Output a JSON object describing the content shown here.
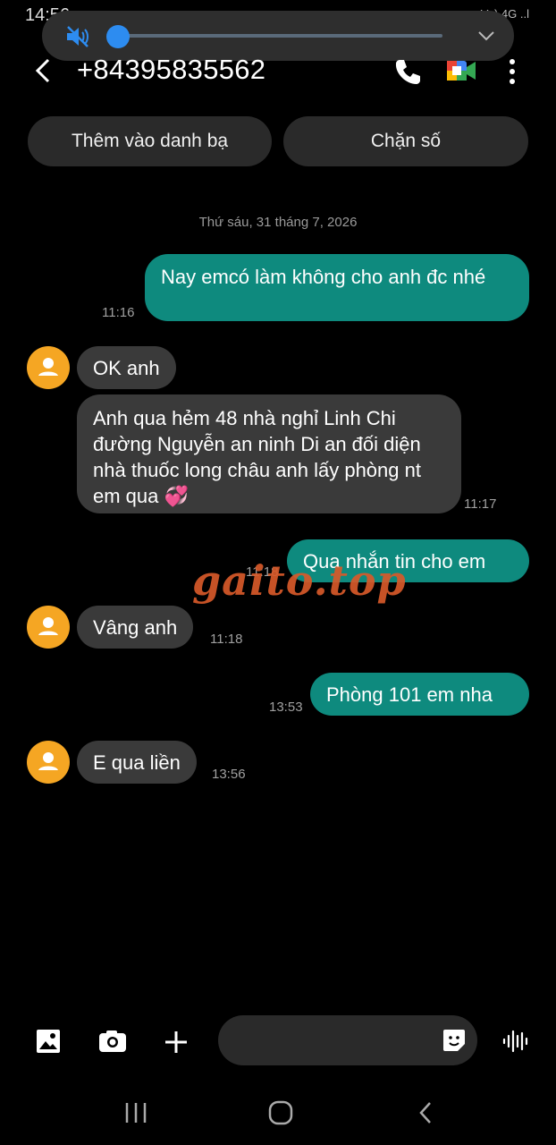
{
  "status": {
    "time": "14:56",
    "indicators": "Vo) 4G ..l"
  },
  "header": {
    "title": "+84395835562",
    "back_icon": "chevron-left-icon",
    "call_icon": "phone-icon",
    "video_icon": "video-call-icon",
    "more_icon": "more-vertical-icon"
  },
  "volume": {
    "icon": "mute-icon",
    "level": 0.0,
    "accent": "#2d8cf0"
  },
  "actions": {
    "add_contact": "Thêm vào danh bạ",
    "block": "Chặn số"
  },
  "date_header": "Thứ sáu, 31 tháng 7, 2026",
  "messages": [
    {
      "dir": "out",
      "text": "Nay emcó làm không cho anh đc nhé",
      "time": "11:16"
    },
    {
      "dir": "in",
      "text": "OK anh",
      "time": ""
    },
    {
      "dir": "in",
      "text": "Anh qua hẻm 48 nhà nghỉ Linh Chi đường Nguyễn an ninh Di an đối diện nhà thuốc long châu anh lấy phòng nt em qua 💞",
      "time": "11:17"
    },
    {
      "dir": "out",
      "text": "Qua  nhắn tin cho em",
      "time": "11:18"
    },
    {
      "dir": "in",
      "text": "Vâng anh",
      "time": "11:18"
    },
    {
      "dir": "out",
      "text": "Phòng 101 em nha",
      "time": "13:53"
    },
    {
      "dir": "in",
      "text": "E qua liền",
      "time": "13:56"
    }
  ],
  "watermark": "gaito.top",
  "colors": {
    "outgoing": "#0e8a7e",
    "incoming": "#3a3a3a",
    "avatar": "#f5a623"
  },
  "composer": {
    "gallery_icon": "image-icon",
    "camera_icon": "camera-icon",
    "add_icon": "plus-icon",
    "sticker_icon": "sticker-icon",
    "voice_icon": "voice-wave-icon"
  },
  "navbar": {
    "recents_icon": "recents-icon",
    "home_icon": "home-icon",
    "back_icon": "nav-back-icon"
  }
}
